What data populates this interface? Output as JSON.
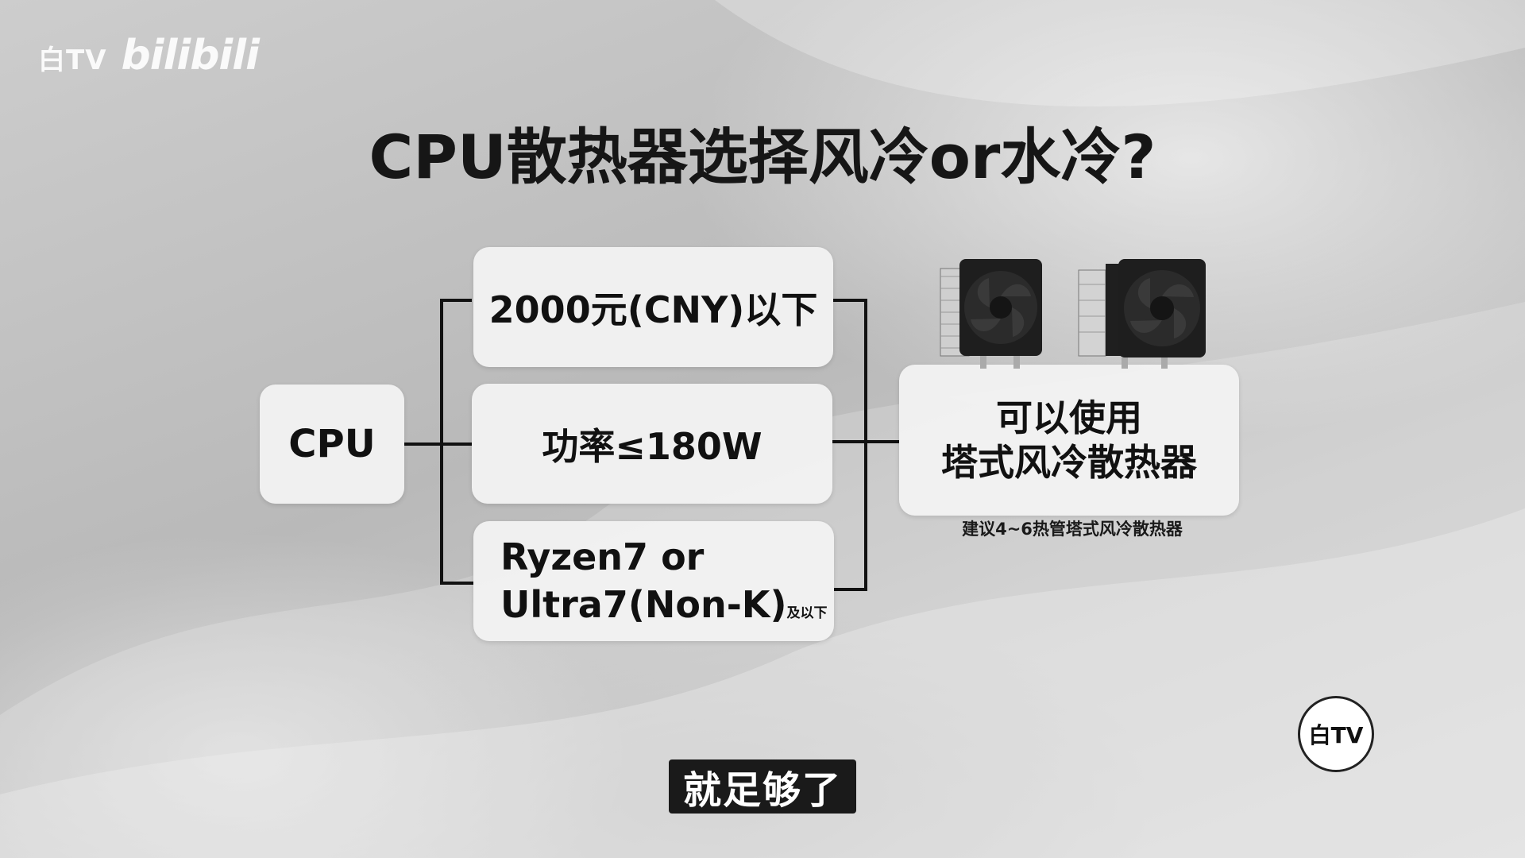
{
  "watermark": {
    "channel": "白TV",
    "brand": "bilibili"
  },
  "title": "CPU散热器选择风冷or水冷?",
  "diagram": {
    "source": "CPU",
    "conditions": [
      {
        "text": "2000元(CNY)以下"
      },
      {
        "text": "功率≤180W"
      },
      {
        "line1": "Ryzen7 or",
        "line2": "Ultra7(Non-K)",
        "suffix": "及以下"
      }
    ],
    "result": {
      "line1": "可以使用",
      "line2": "塔式风冷散热器"
    },
    "note": "建议4~6热管塔式风冷散热器"
  },
  "subtitle": "就足够了",
  "logo": "白TV",
  "colors": {
    "box_fill": "#f2f2f2",
    "line": "#111111",
    "subtitle_bg": "#1a1a1a"
  }
}
